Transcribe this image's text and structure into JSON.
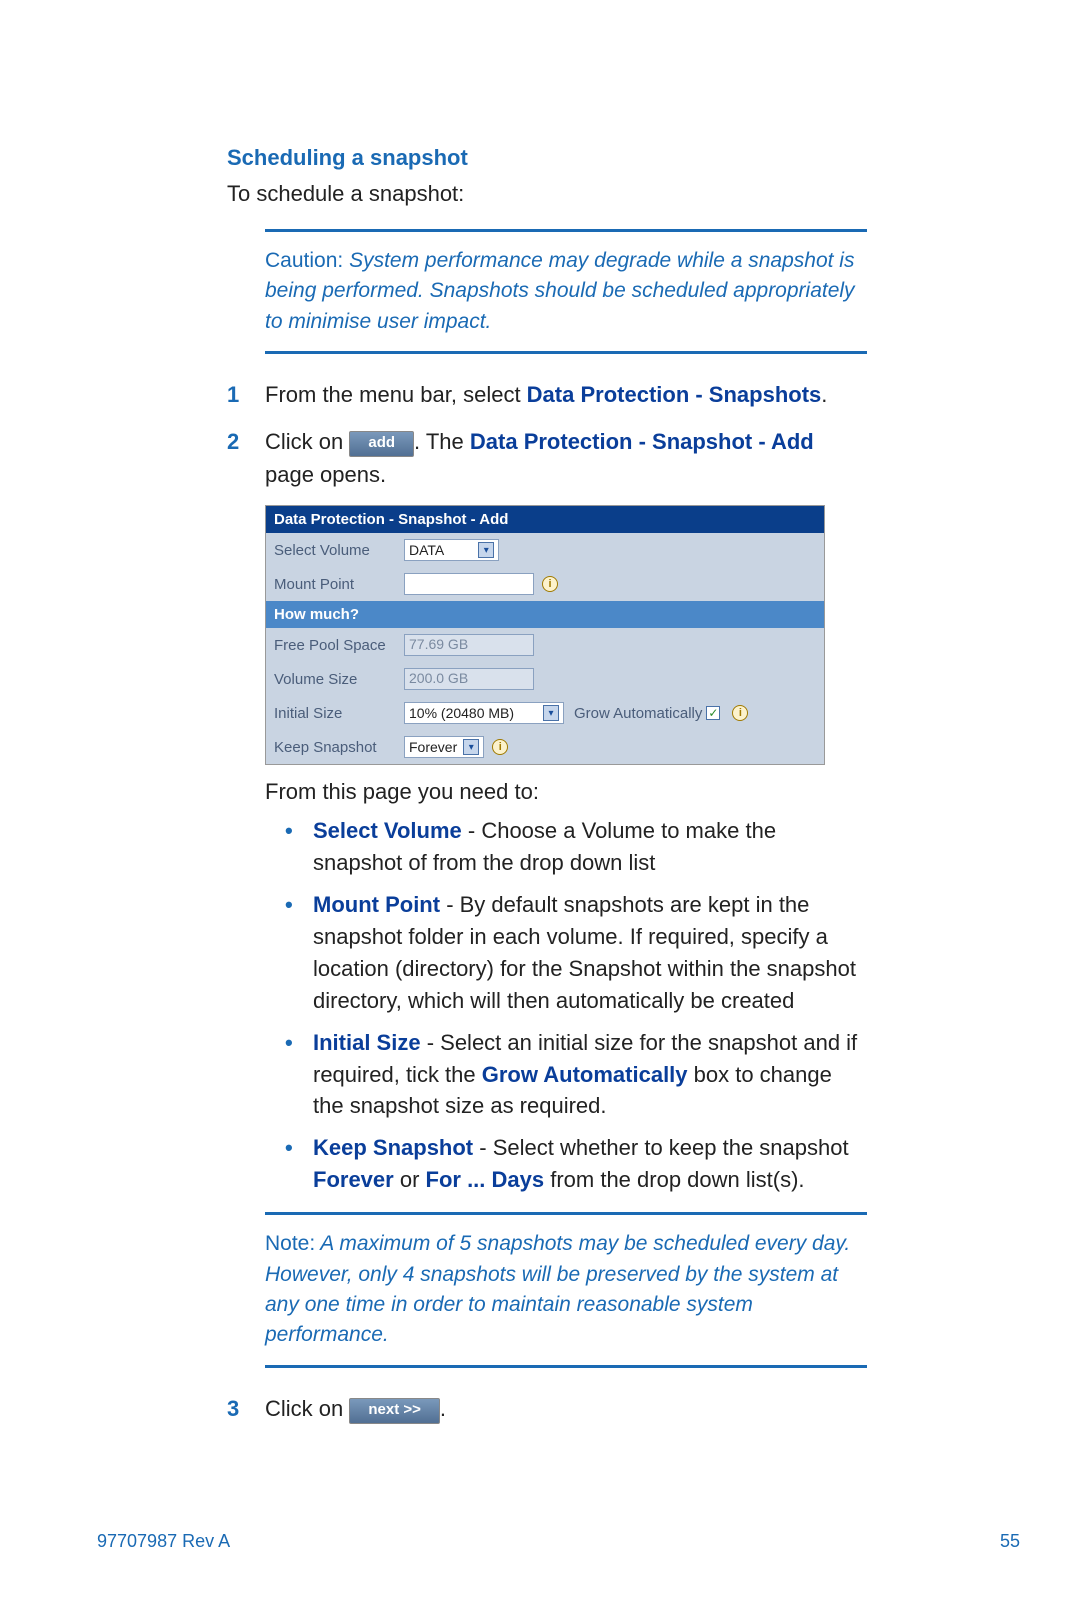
{
  "section_title": "Scheduling a snapshot",
  "intro": "To schedule a snapshot:",
  "caution": {
    "label": "Caution:",
    "text": "System performance may degrade while a snapshot is being performed. Snapshots should be scheduled appropriately to minimise user impact."
  },
  "steps": {
    "s1": {
      "num": "1",
      "pre": "From the menu bar, select ",
      "bold": "Data Protection - Snapshots",
      "post": "."
    },
    "s2": {
      "num": "2",
      "pre": "Click on ",
      "btn": "add",
      "mid": ". The ",
      "bold": "Data Protection - Snapshot - Add",
      "post": " page opens."
    },
    "s3": {
      "num": "3",
      "pre": "Click on ",
      "btn": "next >>",
      "post": "."
    }
  },
  "panel": {
    "header": "Data Protection - Snapshot - Add",
    "rows": {
      "select_volume": {
        "label": "Select Volume",
        "value": "DATA"
      },
      "mount_point": {
        "label": "Mount Point",
        "value": ""
      },
      "how_much": "How much?",
      "free_pool": {
        "label": "Free Pool Space",
        "value": "77.69 GB"
      },
      "volume_size": {
        "label": "Volume Size",
        "value": "200.0 GB"
      },
      "initial_size": {
        "label": "Initial Size",
        "value": "10% (20480 MB)",
        "grow_label": "Grow Automatically"
      },
      "keep_snapshot": {
        "label": "Keep Snapshot",
        "value": "Forever"
      }
    }
  },
  "lead": "From this page you need to:",
  "bullets": {
    "b1": {
      "bold": "Select Volume",
      "rest": " - Choose a Volume to make the snapshot of from the drop down list"
    },
    "b2": {
      "bold": "Mount Point",
      "rest": " - By default snapshots are kept in the snapshot folder in each volume. If required, specify a location (directory) for the Snapshot within the snapshot directory, which will then automatically be created"
    },
    "b3": {
      "bold": "Initial Size",
      "pre": " - Select an initial size for the snapshot and if required, tick the ",
      "bold2": "Grow Automatically",
      "post": " box to change the snapshot size as required."
    },
    "b4": {
      "bold": "Keep Snapshot",
      "pre": " - Select whether to keep the snapshot ",
      "bold2": "Forever",
      "mid": " or ",
      "bold3": "For ... Days",
      "post": " from the drop down list(s)."
    }
  },
  "note": {
    "label": "Note:",
    "text": "A maximum of 5 snapshots may be scheduled every day. However, only 4 snapshots will be preserved by the system at any one time in order to maintain reasonable system performance."
  },
  "footer": {
    "left": "97707987 Rev A",
    "right": "55"
  }
}
